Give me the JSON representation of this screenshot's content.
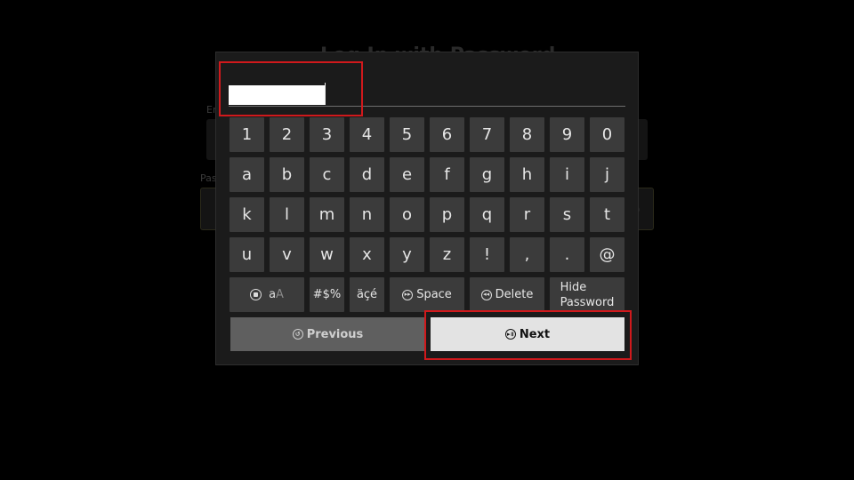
{
  "background": {
    "title": "Log In with Password",
    "email_label": "Email",
    "password_label": "Password"
  },
  "input": {
    "value": "",
    "type": "text"
  },
  "keyboard": {
    "rows": [
      [
        "1",
        "2",
        "3",
        "4",
        "5",
        "6",
        "7",
        "8",
        "9",
        "0"
      ],
      [
        "a",
        "b",
        "c",
        "d",
        "e",
        "f",
        "g",
        "h",
        "i",
        "j"
      ],
      [
        "k",
        "l",
        "m",
        "n",
        "o",
        "p",
        "q",
        "r",
        "s",
        "t"
      ],
      [
        "u",
        "v",
        "w",
        "x",
        "y",
        "z",
        "!",
        ",",
        ".",
        "@"
      ]
    ],
    "case_key": {
      "lower": "a",
      "upper": "A",
      "icon": "menu-button-icon"
    },
    "symbols_label": "#$%",
    "accents_label": "äçé",
    "space_label": "Space",
    "space_icon": "fast-forward-icon",
    "delete_label": "Delete",
    "delete_icon": "rewind-icon",
    "hide_password_line1": "Hide",
    "hide_password_line2": "Password"
  },
  "buttons": {
    "previous_label": "Previous",
    "previous_icon": "back-icon",
    "next_label": "Next",
    "next_icon": "play-pause-icon"
  },
  "colors": {
    "highlight": "#d0191c",
    "key_bg": "#3b3b3b",
    "next_bg": "#e3e3e3",
    "previous_bg": "#5f5f5f"
  }
}
